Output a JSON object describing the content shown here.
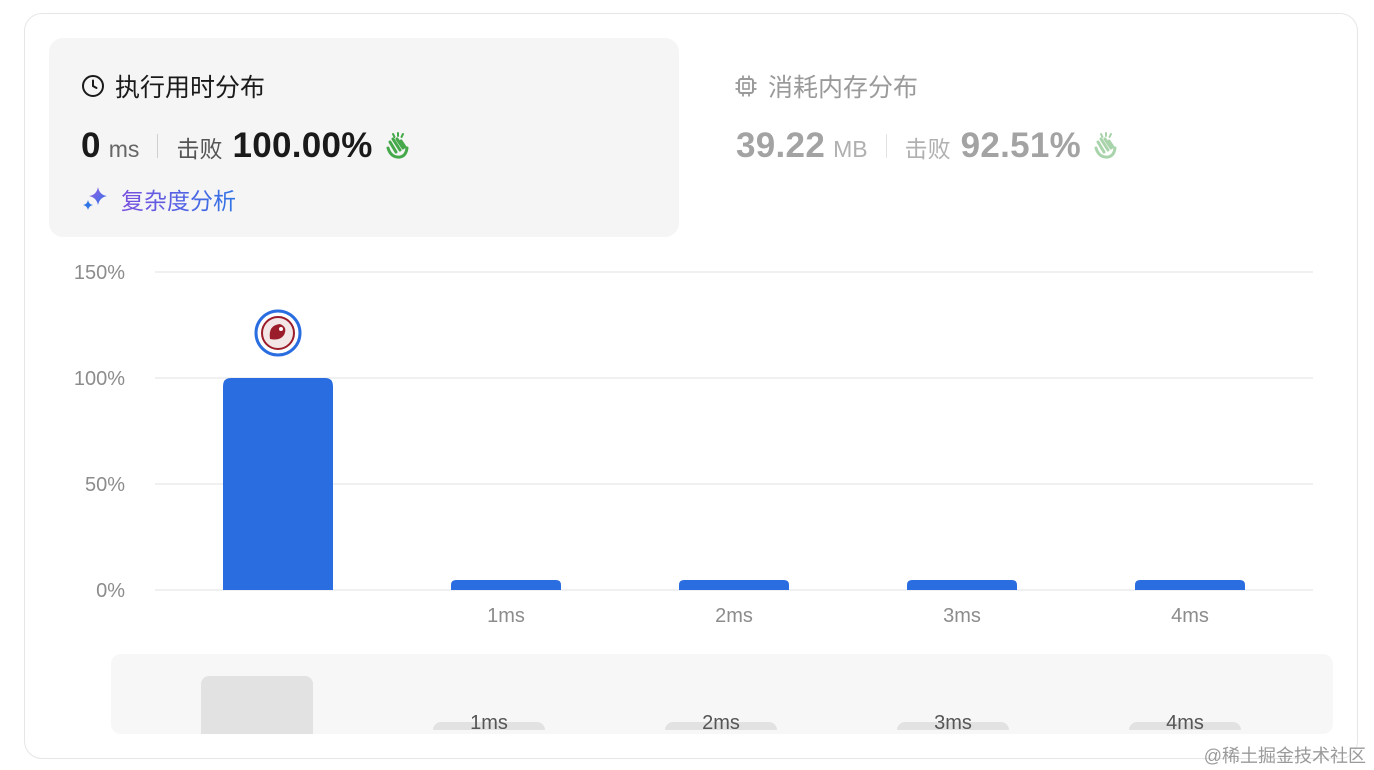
{
  "runtime": {
    "title": "执行用时分布",
    "value": "0",
    "unit": "ms",
    "beat_label": "击败",
    "beat_percent": "100.00%",
    "analysis_label": "复杂度分析"
  },
  "memory": {
    "title": "消耗内存分布",
    "value": "39.22",
    "unit": "MB",
    "beat_label": "击败",
    "beat_percent": "92.51%"
  },
  "chart_data": {
    "type": "bar",
    "categories": [
      "",
      "1ms",
      "2ms",
      "3ms",
      "4ms"
    ],
    "values": [
      100,
      1.5,
      1.5,
      1.5,
      1.5
    ],
    "ylim": [
      0,
      150
    ],
    "y_ticks": [
      "0%",
      "50%",
      "100%",
      "150%"
    ],
    "y_tick_values": [
      0,
      50,
      100,
      150
    ],
    "grid": true,
    "highlight_index": 0,
    "bar_color": "#2a6de0",
    "gridline_color": "#e8e8e8"
  },
  "overview": {
    "labels": [
      "",
      "1ms",
      "2ms",
      "3ms",
      "4ms"
    ]
  },
  "watermark": "@稀土掘金技术社区",
  "colors": {
    "accent_green": "#45a84a",
    "accent_purple": "#7a4fe0",
    "accent_blue": "#2f74e6"
  }
}
